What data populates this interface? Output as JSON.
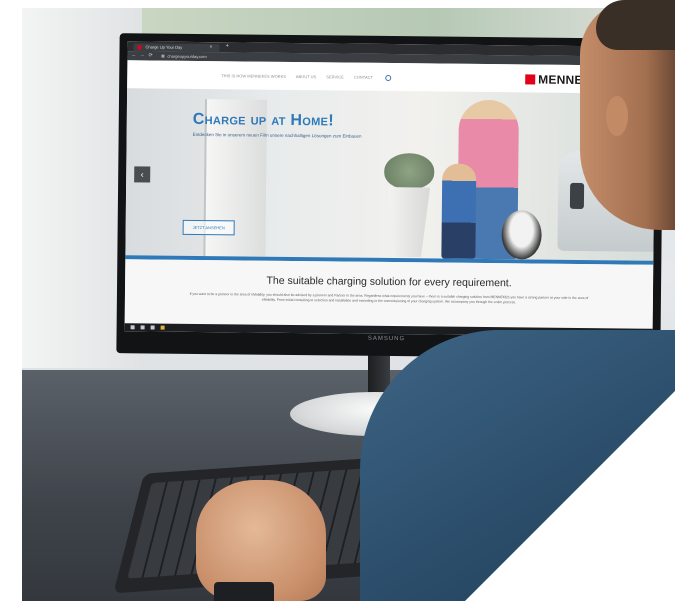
{
  "browser": {
    "tab_title": "Charge Up Your Day",
    "tab_close": "×",
    "tab_add": "+",
    "url": "chargeupyourday.com",
    "back": "←",
    "forward": "→",
    "reload": "⟳"
  },
  "site": {
    "nav": [
      "THIS IS HOW MENNEKES WORKS",
      "ABOUT US",
      "SERVICE",
      "CONTACT"
    ],
    "logo_text": "MENNEKES",
    "brand_color": "#e2001a",
    "accent_color": "#2f79b8",
    "hero": {
      "title": "Charge up at Home!",
      "subtitle": "Entdecken Sie in unserem neuen Film unsere nachhaltigen Lösungen zum Einbauen",
      "button": "JETZT ANSEHEN",
      "prev_arrow": "‹"
    },
    "headline": "The suitable charging solution for every requirement.",
    "paragraph": "If you want to be a pioneer in the area of eMobility, you should also be advised by a pioneer and Partner in the area. Regardless what requirements you have – there is a suitable charging solution from MENNEKES you have a strong partner at your side in the area of eMobility. From initial consulting to selection and installation and extending to the commissioning of your charging system. We accompany you through the entire process."
  },
  "monitor": {
    "brand": "SAMSUNG"
  }
}
